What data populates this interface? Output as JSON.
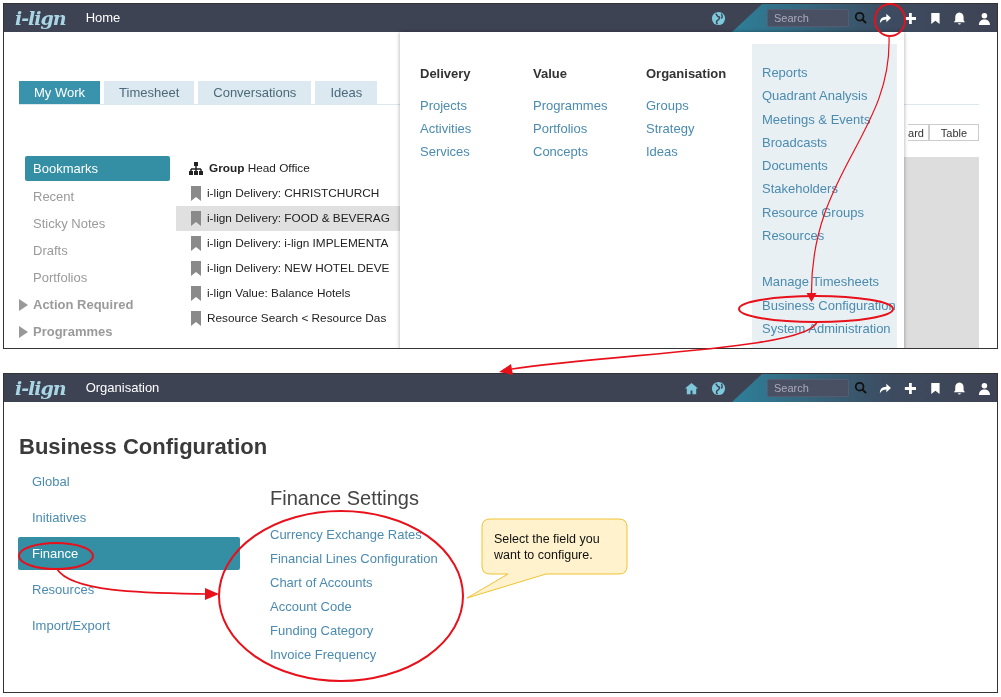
{
  "top_screen": {
    "header": {
      "logo": "i-lign",
      "title": "Home",
      "search": {
        "placeholder": "Search"
      }
    },
    "tabs": [
      {
        "label": "My Work",
        "selected": true
      },
      {
        "label": "Timesheet",
        "selected": false
      },
      {
        "label": "Conversations",
        "selected": false
      },
      {
        "label": "Ideas",
        "selected": false
      }
    ],
    "sidebar": {
      "items": [
        {
          "label": "Bookmarks",
          "kind": "link",
          "selected": true
        },
        {
          "label": "Recent",
          "kind": "link",
          "selected": false
        },
        {
          "label": "Sticky Notes",
          "kind": "link",
          "selected": false
        },
        {
          "label": "Drafts",
          "kind": "link",
          "selected": false
        },
        {
          "label": "Portfolios",
          "kind": "link",
          "selected": false
        },
        {
          "label": "Action Required",
          "kind": "expandable",
          "expanded": false,
          "selected": false
        },
        {
          "label": "Programmes",
          "kind": "expandable",
          "expanded": false,
          "selected": false
        }
      ]
    },
    "bookmarks": [
      {
        "text": "**Group** Head Office",
        "kind": "group",
        "selected": false
      },
      {
        "text": "i-lign Delivery: CHRISTCHURCH",
        "kind": "bookmark",
        "selected": false
      },
      {
        "text": "i-lign Delivery: FOOD & BEVERAG",
        "kind": "bookmark",
        "selected": true
      },
      {
        "text": "i-lign Delivery: i-lign IMPLEMENTA",
        "kind": "bookmark",
        "selected": false
      },
      {
        "text": "i-lign Delivery: NEW HOTEL DEVE",
        "kind": "bookmark",
        "selected": false
      },
      {
        "text": "i-lign Value: Balance Hotels",
        "kind": "bookmark",
        "selected": false
      },
      {
        "text": "Resource Search < Resource Das",
        "kind": "bookmark",
        "selected": false
      }
    ],
    "view_toggle": [
      "ard",
      "Table"
    ],
    "nav_menu": {
      "columns": [
        {
          "heading": "Delivery",
          "links": [
            "Projects",
            "Activities",
            "Services"
          ]
        },
        {
          "heading": "Value",
          "links": [
            "Programmes",
            "Portfolios",
            "Concepts"
          ]
        },
        {
          "heading": "Organisation",
          "links": [
            "Groups",
            "Strategy",
            "Ideas"
          ]
        }
      ],
      "side_links": [
        [
          "Reports",
          "Quadrant Analysis",
          "Meetings & Events",
          "Broadcasts",
          "Documents",
          "Stakeholders",
          "Resource Groups",
          "Resources"
        ],
        [
          "Manage Timesheets",
          "Business Configuration",
          "System Administration"
        ]
      ]
    }
  },
  "bottom_screen": {
    "header": {
      "logo": "i-lign",
      "title": "Organisation",
      "search": {
        "placeholder": "Search"
      },
      "home_icon": true
    },
    "page_title": "Business Configuration",
    "sidebar": {
      "items": [
        {
          "label": "Global",
          "selected": false
        },
        {
          "label": "Initiatives",
          "selected": false
        },
        {
          "label": "Finance",
          "selected": true
        },
        {
          "label": "Resources",
          "selected": false
        },
        {
          "label": "Import/Export",
          "selected": false
        }
      ]
    },
    "section_title": "Finance Settings",
    "links": [
      "Currency Exchange Rates",
      "Financial Lines Configuration",
      "Chart of Accounts",
      "Account Code",
      "Funding Category",
      "Invoice Frequency"
    ]
  },
  "callout": {
    "text": "Select the field you want to configure."
  }
}
